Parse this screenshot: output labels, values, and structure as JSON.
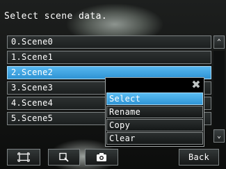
{
  "prompt": "Select scene data.",
  "scenes": [
    {
      "label": "0.Scene0",
      "selected": false
    },
    {
      "label": "1.Scene1",
      "selected": false
    },
    {
      "label": "2.Scene2",
      "selected": true
    },
    {
      "label": "3.Scene3",
      "selected": false
    },
    {
      "label": "4.Scene4",
      "selected": false
    },
    {
      "label": "5.Scene5",
      "selected": false
    }
  ],
  "scrollbar": {
    "up_icon": "chevron-up-icon",
    "down_icon": "chevron-down-icon",
    "up_glyph": "⌃",
    "down_glyph": "⌄"
  },
  "context_menu": {
    "close_glyph": "✖",
    "items": [
      {
        "label": "Select",
        "active": true
      },
      {
        "label": "Rename",
        "active": false
      },
      {
        "label": "Copy",
        "active": false
      },
      {
        "label": "Clear",
        "active": false
      }
    ]
  },
  "toolbar": {
    "buttons": [
      {
        "icon": "fit-screen-icon"
      },
      {
        "icon": "zoom-icon"
      },
      {
        "icon": "camera-icon"
      }
    ],
    "back_label": "Back"
  },
  "colors": {
    "selected_row": "#3ea6e2",
    "accent": "#56b7f0"
  }
}
